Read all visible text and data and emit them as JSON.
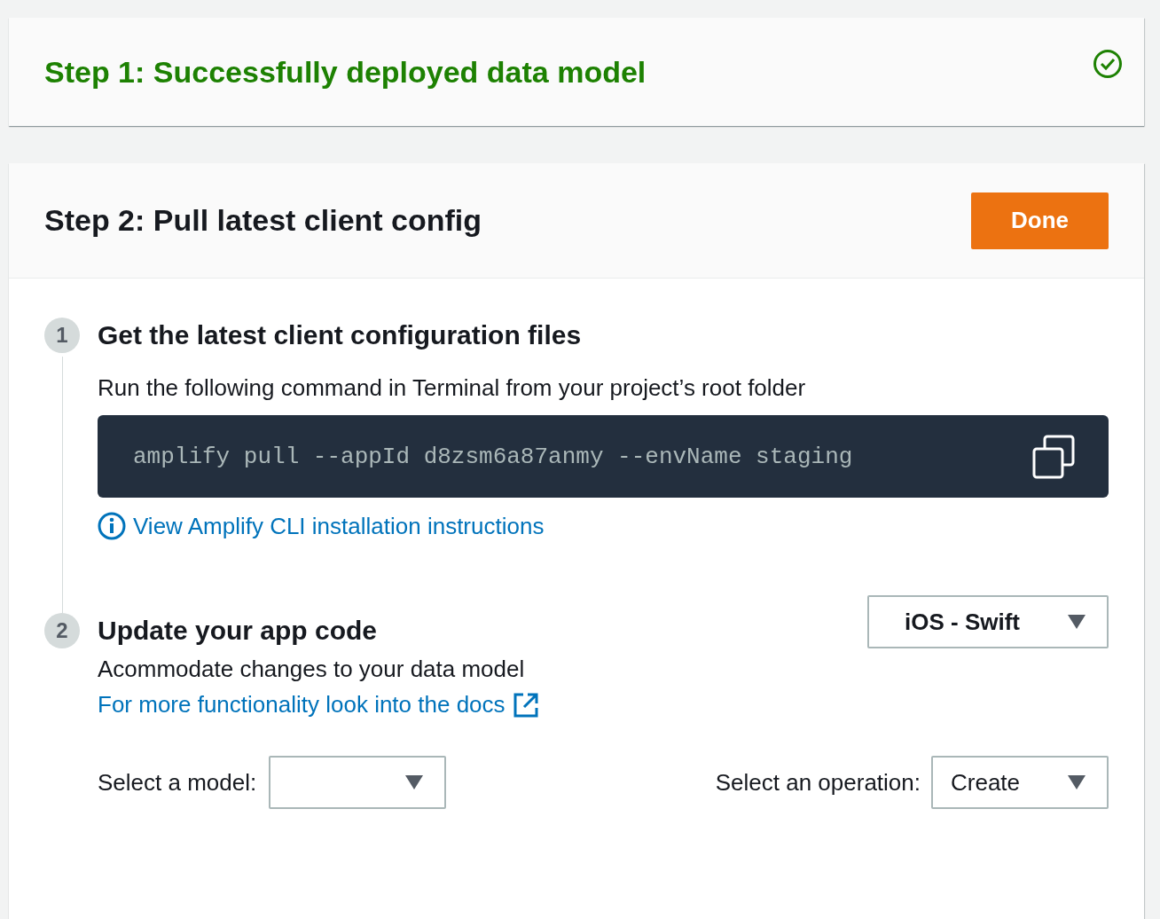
{
  "step1": {
    "title": "Step 1: Successfully deployed data model",
    "completed": true
  },
  "step2": {
    "title": "Step 2: Pull latest client config",
    "button": "Done"
  },
  "get_files": {
    "number": "1",
    "title": "Get the latest client configuration files",
    "description": "Run the following command in Terminal from your project’s root folder",
    "command": "amplify pull --appId d8zsm6a87anmy --envName staging",
    "link": "View Amplify CLI installation instructions"
  },
  "update_code": {
    "number": "2",
    "title": "Update your app code",
    "platform": "iOS - Swift",
    "description": "Acommodate changes to your data model",
    "link": "For more functionality look into the docs",
    "model_label": "Select a model:",
    "operation_label": "Select an operation:",
    "operation": "Create"
  }
}
